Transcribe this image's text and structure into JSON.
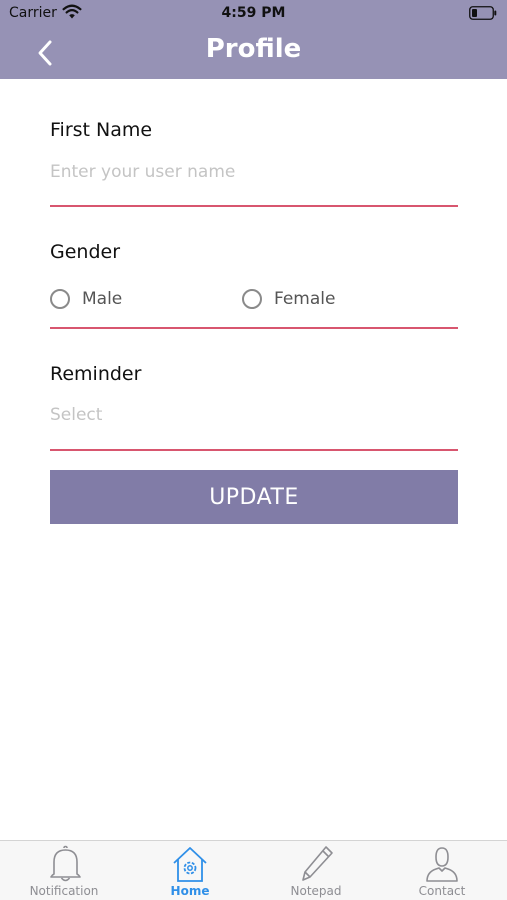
{
  "status_bar": {
    "carrier": "Carrier",
    "time": "4:59 PM"
  },
  "header": {
    "title": "Profile",
    "back_icon": "chevron-left-icon"
  },
  "form": {
    "first_name": {
      "label": "First Name",
      "placeholder": "Enter your user name",
      "value": ""
    },
    "gender": {
      "label": "Gender",
      "options": [
        "Male",
        "Female"
      ],
      "selected": null
    },
    "reminder": {
      "label": "Reminder",
      "placeholder": "Select"
    }
  },
  "update_button": {
    "label": "UPDATE"
  },
  "tab_bar": {
    "items": [
      {
        "label": "Notification",
        "icon": "bell-icon"
      },
      {
        "label": "Home",
        "icon": "home-gear-icon",
        "active": true
      },
      {
        "label": "Notepad",
        "icon": "pencil-icon"
      },
      {
        "label": "Contact",
        "icon": "person-icon"
      }
    ]
  },
  "colors": {
    "header": "#9692b5",
    "accent_button": "#817ca7",
    "underline": "#d8566f",
    "tab_active": "#2f8fe8",
    "tab_inactive": "#8e8e93"
  }
}
